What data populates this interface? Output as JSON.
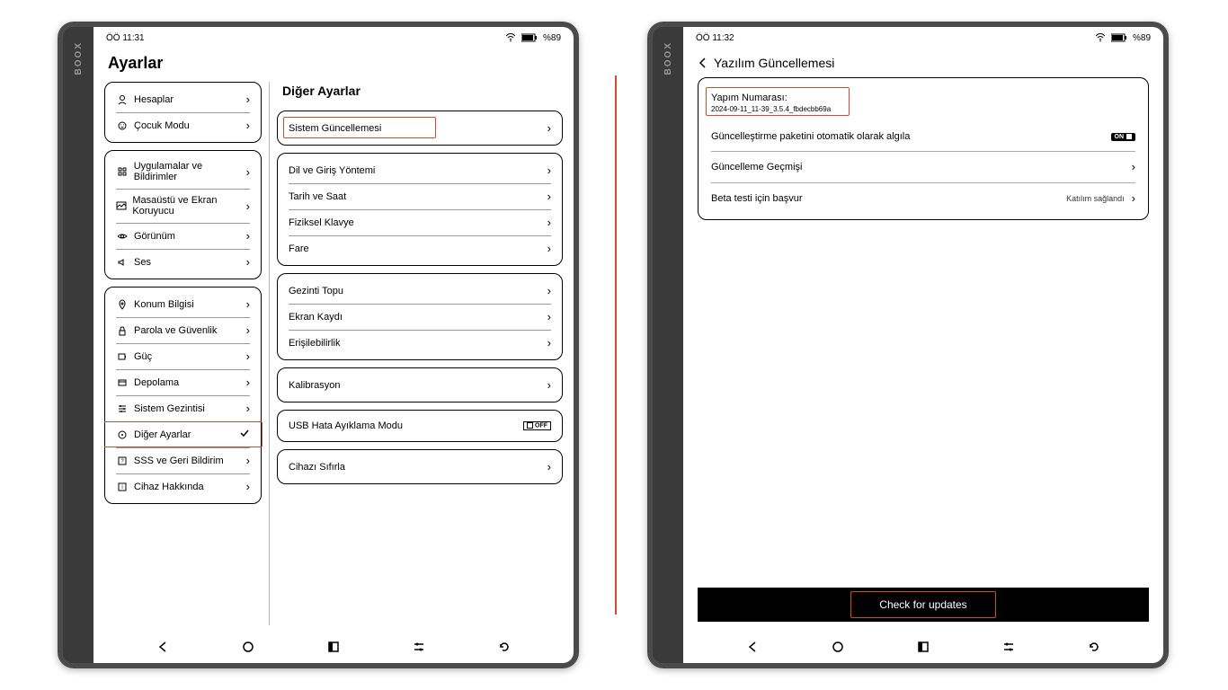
{
  "brand": "BOOX",
  "left": {
    "status": {
      "time": "ÖÖ 11:31",
      "battery": "%89"
    },
    "title": "Ayarlar",
    "sidebar_groups": [
      {
        "items": [
          {
            "icon": "user",
            "label": "Hesaplar"
          },
          {
            "icon": "child",
            "label": "Çocuk Modu"
          }
        ]
      },
      {
        "items": [
          {
            "icon": "apps",
            "label": "Uygulamalar ve Bildirimler"
          },
          {
            "icon": "image",
            "label": "Masaüstü ve Ekran Koruyucu"
          },
          {
            "icon": "eye",
            "label": "Görünüm"
          },
          {
            "icon": "sound",
            "label": "Ses"
          }
        ]
      },
      {
        "items": [
          {
            "icon": "pin",
            "label": "Konum Bilgisi"
          },
          {
            "icon": "lock",
            "label": "Parola ve Güvenlik"
          },
          {
            "icon": "power",
            "label": "Güç"
          },
          {
            "icon": "storage",
            "label": "Depolama"
          },
          {
            "icon": "nav",
            "label": "Sistem Gezintisi"
          },
          {
            "icon": "more",
            "label": "Diğer Ayarlar",
            "selected": true,
            "highlighted": true
          },
          {
            "icon": "faq",
            "label": "SSS ve Geri Bildirim"
          },
          {
            "icon": "info",
            "label": "Cihaz Hakkında"
          }
        ]
      }
    ],
    "main_title": "Diğer Ayarlar",
    "main_groups": [
      {
        "items": [
          {
            "label": "Sistem Güncellemesi",
            "highlighted": true
          }
        ]
      },
      {
        "items": [
          {
            "label": "Dil ve Giriş Yöntemi"
          },
          {
            "label": "Tarih ve Saat"
          },
          {
            "label": "Fiziksel Klavye"
          },
          {
            "label": "Fare"
          }
        ]
      },
      {
        "items": [
          {
            "label": "Gezinti Topu"
          },
          {
            "label": "Ekran Kaydı"
          },
          {
            "label": "Erişilebilirlik"
          }
        ]
      },
      {
        "items": [
          {
            "label": "Kalibrasyon"
          }
        ]
      },
      {
        "items": [
          {
            "label": "USB Hata Ayıklama Modu",
            "trailing": "off"
          }
        ]
      },
      {
        "items": [
          {
            "label": "Cihazı Sıfırla"
          }
        ]
      }
    ]
  },
  "right": {
    "status": {
      "time": "ÖÖ 11:32",
      "battery": "%89"
    },
    "back_title": "Yazılım Güncellemesi",
    "build_label": "Yapım Numarası:",
    "build_value": "2024-09-11_11-39_3.5.4_fbdecbb69a",
    "rows": [
      {
        "label": "Güncelleştirme paketini otomatik olarak algıla",
        "trailing": "on"
      },
      {
        "label": "Güncelleme Geçmişi",
        "trailing": "chev"
      },
      {
        "label": "Beta testi için başvur",
        "note": "Katılım sağlandı",
        "trailing": "chev"
      }
    ],
    "check_button": "Check for updates"
  }
}
